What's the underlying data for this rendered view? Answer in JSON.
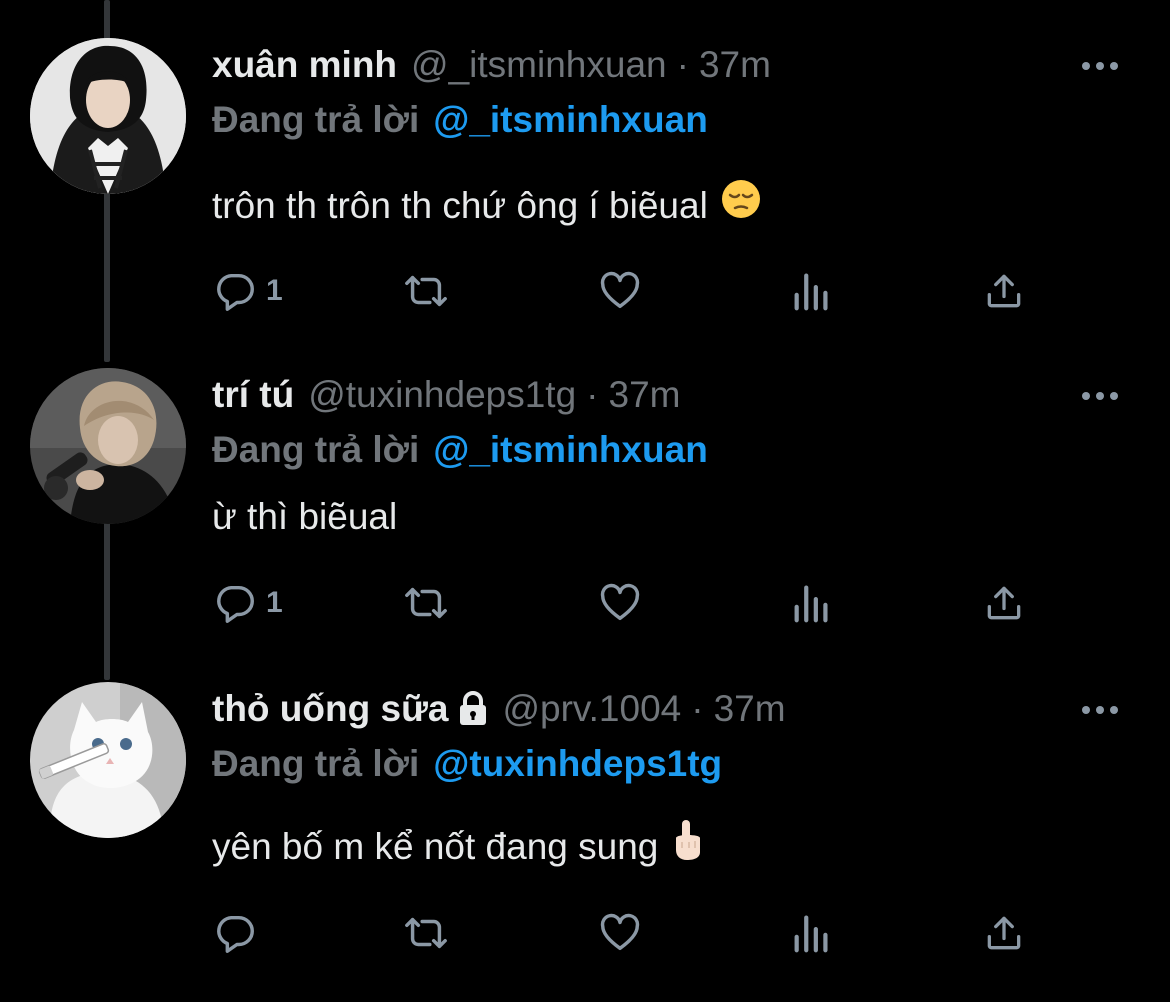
{
  "colors": {
    "background": "#000000",
    "primary_text": "#e7e9ea",
    "secondary_text": "#71767b",
    "accent": "#1d9bf0",
    "icon": "#8b98a5",
    "thread_line": "#333639"
  },
  "tweets": [
    {
      "name": "xuân minh",
      "handle": "@_itsminhxuan",
      "separator": "·",
      "time": "37m",
      "reply_prefix": "Đang trả lời",
      "reply_to": "@_itsminhxuan",
      "text": "trôn th trôn th chứ ông í biẽual",
      "emoji": "pensive-face",
      "locked": false,
      "reply_count": "1",
      "avatar": "person-in-hoodie-photo"
    },
    {
      "name": "trí tú",
      "handle": "@tuxinhdeps1tg",
      "separator": "·",
      "time": "37m",
      "reply_prefix": "Đang trả lời",
      "reply_to": "@_itsminhxuan",
      "text": "ừ thì biẽual",
      "emoji": "",
      "locked": false,
      "reply_count": "1",
      "avatar": "person-with-microphone-photo"
    },
    {
      "name": "thỏ uống sữa",
      "handle": "@prv.1004",
      "separator": "·",
      "time": "37m",
      "reply_prefix": "Đang trả lời",
      "reply_to": "@tuxinhdeps1tg",
      "text": "yên bố m kể nốt đang sung",
      "emoji": "index-pointing-up",
      "locked": true,
      "reply_count": "",
      "avatar": "white-cat-photo"
    }
  ],
  "action_icons": [
    "reply-icon",
    "retweet-icon",
    "like-icon",
    "views-icon",
    "share-icon"
  ]
}
